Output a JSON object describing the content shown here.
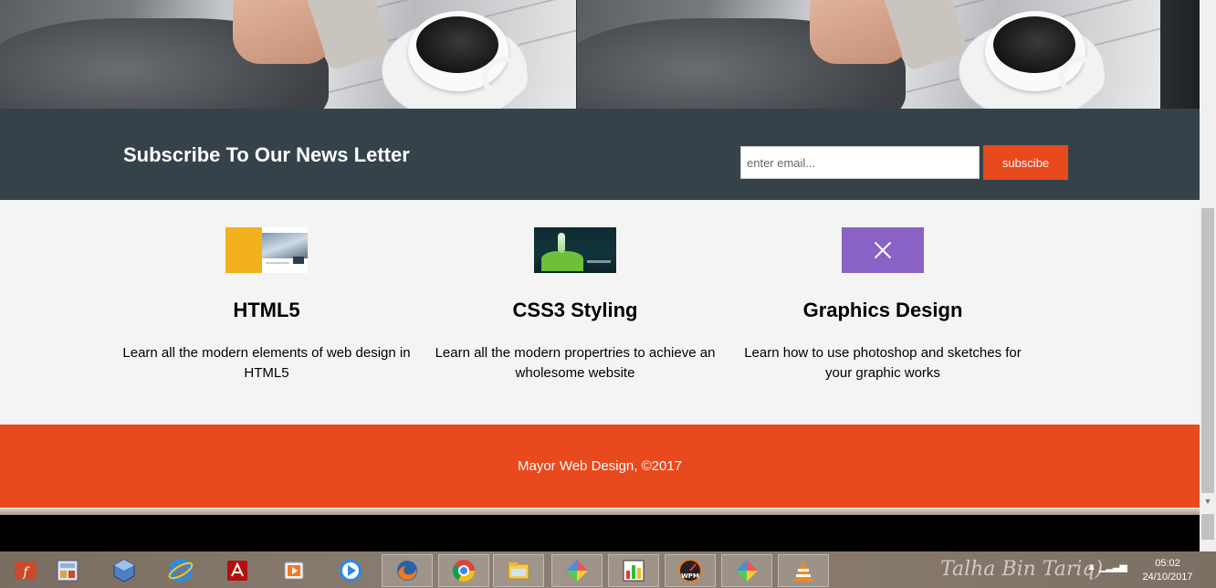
{
  "newsletter": {
    "title": "Subscribe To Our News Letter",
    "email_placeholder": "enter email...",
    "button_label": "subscibe"
  },
  "features": [
    {
      "title": "HTML5",
      "text": "Learn all the modern elements of web design in HTML5"
    },
    {
      "title": "CSS3 Styling",
      "text": "Learn all the modern propertries to achieve an wholesome website"
    },
    {
      "title": "Graphics Design",
      "text": "Learn how to use photoshop and sketches for your graphic works"
    }
  ],
  "footer": {
    "text": "Mayor Web Design, ©2017"
  },
  "taskbar": {
    "apps": [
      "flash-icon",
      "calculator-icon",
      "virtualbox-icon",
      "internet-explorer-icon",
      "acrobat-icon",
      "media-player-icon",
      "video-player-icon",
      "firefox-icon",
      "chrome-icon",
      "file-explorer-icon",
      "diamond-app-icon",
      "charts-icon",
      "wpm-icon",
      "diamond-app-icon-2",
      "vlc-icon"
    ],
    "time": "05:02",
    "date": "24/10/2017"
  },
  "colors": {
    "accent": "#e8491d",
    "dark": "#35424a",
    "light_bg": "#f4f4f4"
  }
}
